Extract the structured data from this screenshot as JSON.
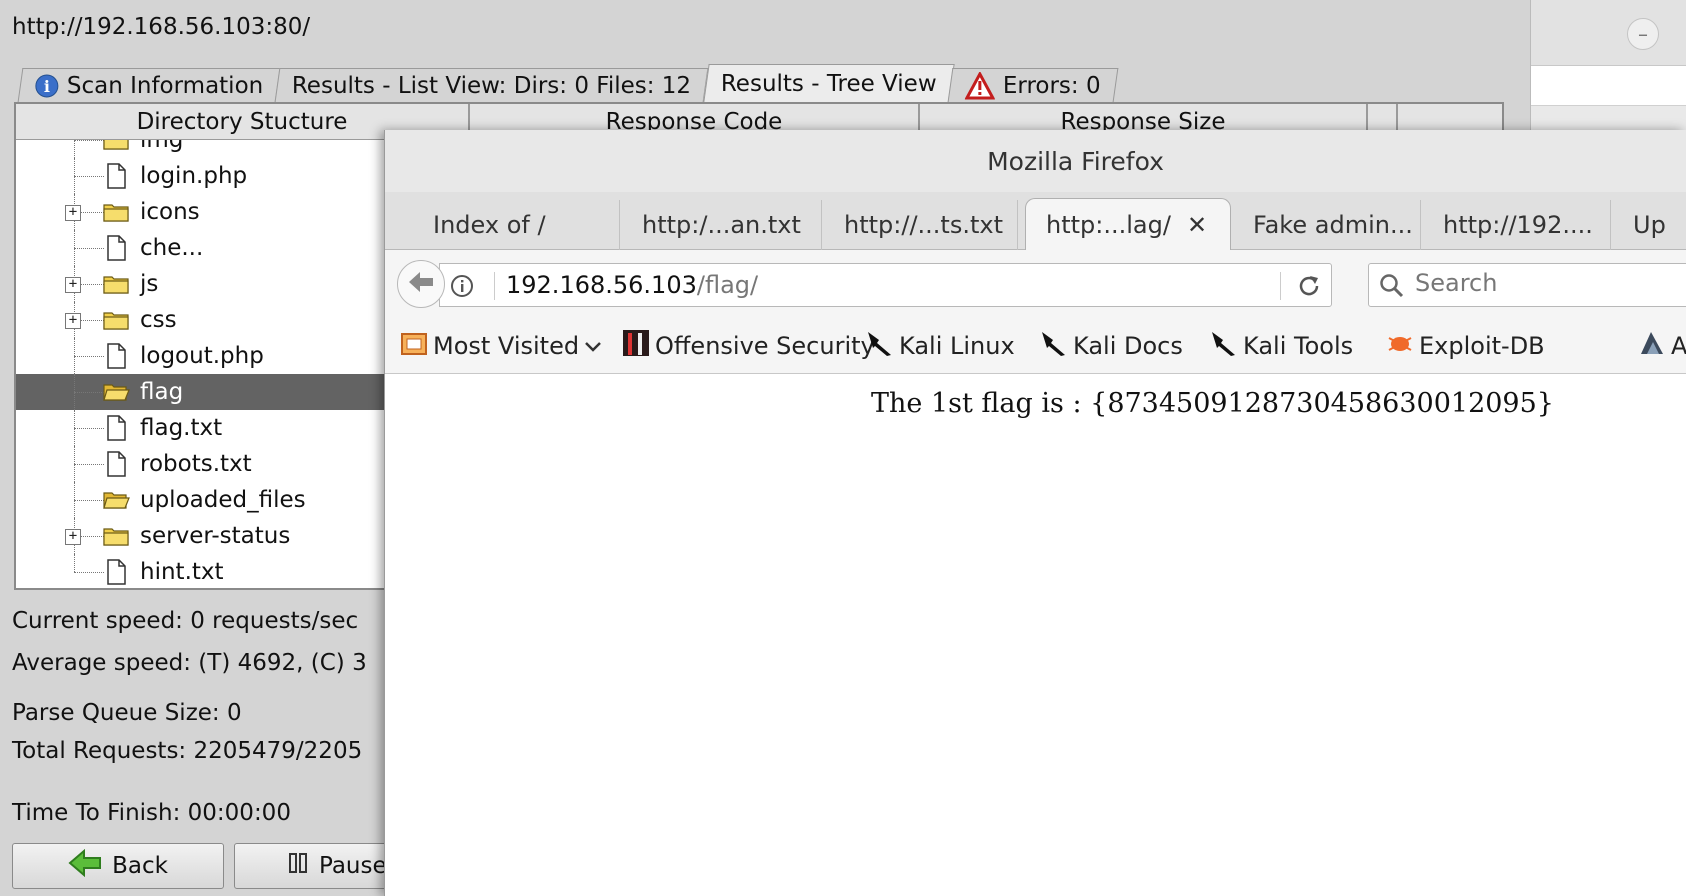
{
  "dirbuster": {
    "target_url": "http://192.168.56.103:80/",
    "tabs": [
      {
        "label": "Scan Information",
        "icon": "info-icon"
      },
      {
        "label": "Results - List View: Dirs: 0 Files: 12"
      },
      {
        "label": "Results - Tree View"
      },
      {
        "label": "Errors: 0",
        "icon": "warning-icon"
      }
    ],
    "columns": [
      "Directory Stucture",
      "Response Code",
      "Response Size"
    ],
    "tree": [
      {
        "label": "img",
        "type": "folder"
      },
      {
        "label": "login.php",
        "type": "file"
      },
      {
        "label": "icons",
        "type": "folder"
      },
      {
        "label": "che...",
        "type": "file"
      },
      {
        "label": "js",
        "type": "folder"
      },
      {
        "label": "css",
        "type": "folder"
      },
      {
        "label": "logout.php",
        "type": "file"
      },
      {
        "label": "flag",
        "type": "folder-open"
      },
      {
        "label": "flag.txt",
        "type": "file"
      },
      {
        "label": "robots.txt",
        "type": "file"
      },
      {
        "label": "uploaded_files",
        "type": "folder-open"
      },
      {
        "label": "server-status",
        "type": "folder"
      },
      {
        "label": "hint.txt",
        "type": "file"
      }
    ],
    "stats": {
      "current_speed": "Current speed: 0 requests/sec",
      "average_speed": "Average speed: (T) 4692, (C) 3",
      "parse_queue": "Parse Queue Size: 0",
      "total_requests": "Total Requests: 2205479/2205",
      "time_to_finish": "Time To Finish: 00:00:00"
    },
    "buttons": {
      "back": "Back",
      "pause": "Pause"
    }
  },
  "firefox": {
    "window_title": "Mozilla Firefox",
    "tabs": [
      {
        "label": "Index of /"
      },
      {
        "label": "http:/...an.txt"
      },
      {
        "label": "http://...ts.txt"
      },
      {
        "label": "http:...lag/",
        "active": true
      },
      {
        "label": "Fake admin..."
      },
      {
        "label": "http://192...."
      },
      {
        "label": "Up"
      }
    ],
    "url_host": "192.168.56.103",
    "url_path": "/flag/",
    "search_placeholder": "Search",
    "bookmarks": [
      {
        "label": "Most Visited",
        "icon": "most-visited-icon"
      },
      {
        "label": "Offensive Security",
        "icon": "offsec-icon"
      },
      {
        "label": "Kali Linux",
        "icon": "kali-icon"
      },
      {
        "label": "Kali Docs",
        "icon": "kali-icon"
      },
      {
        "label": "Kali Tools",
        "icon": "kali-icon"
      },
      {
        "label": "Exploit-DB",
        "icon": "exploitdb-icon"
      },
      {
        "label": "A",
        "icon": "aircrack-icon"
      }
    ],
    "page_text": "The 1st flag is : {8734509128730458630012095}"
  },
  "colors": {
    "selected_row": "#636363",
    "firefox_bg": "#f5f5f5",
    "folder_yellow": "#f2d04a",
    "exploit_orange": "#f06a2a"
  }
}
